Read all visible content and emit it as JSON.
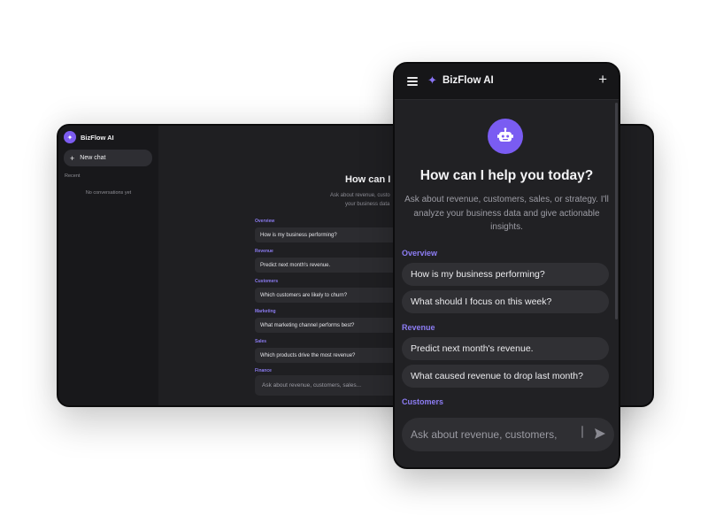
{
  "desktop": {
    "brand": "BizFlow AI",
    "new_chat": "New chat",
    "recent_label": "Recent",
    "empty_text": "No conversations yet",
    "heading": "How can I l",
    "subtitle_line1": "Ask about revenue, custo",
    "subtitle_line2": "your business data",
    "categories": [
      {
        "label": "Overview",
        "prompt": "How is my business performing?"
      },
      {
        "label": "Revenue",
        "prompt": "Predict next month's revenue."
      },
      {
        "label": "Customers",
        "prompt": "Which customers are likely to churn?"
      },
      {
        "label": "Marketing",
        "prompt": "What marketing channel performs best?"
      },
      {
        "label": "Sales",
        "prompt": "Which products drive the most revenue?"
      },
      {
        "label": "Finance"
      }
    ],
    "input_placeholder": "Ask about revenue, customers, sales..."
  },
  "mobile": {
    "brand": "BizFlow AI",
    "heading": "How can I help you today?",
    "subtitle_lines": [
      "Ask about revenue, customers, sales, or strategy. I'll",
      "analyze your business data and give actionable",
      "insights."
    ],
    "sections": [
      {
        "label": "Overview",
        "prompts": [
          "How is my business performing?",
          "What should I focus on this week?"
        ]
      },
      {
        "label": "Revenue",
        "prompts": [
          "Predict next month's revenue.",
          "What caused revenue to drop last month?"
        ]
      },
      {
        "label": "Customers",
        "prompts": []
      }
    ],
    "input_placeholder": "Ask about revenue, customers,"
  },
  "icons": {
    "logo": "sparkle-icon",
    "menu": "hamburger-menu-icon",
    "new": "plus-icon",
    "avatar": "robot-icon",
    "send": "send-icon"
  },
  "colors": {
    "accent": "#7c5cf0",
    "category_label": "#8d7df4",
    "background_dark": "#1f1f22",
    "sidebar": "#18181b"
  }
}
